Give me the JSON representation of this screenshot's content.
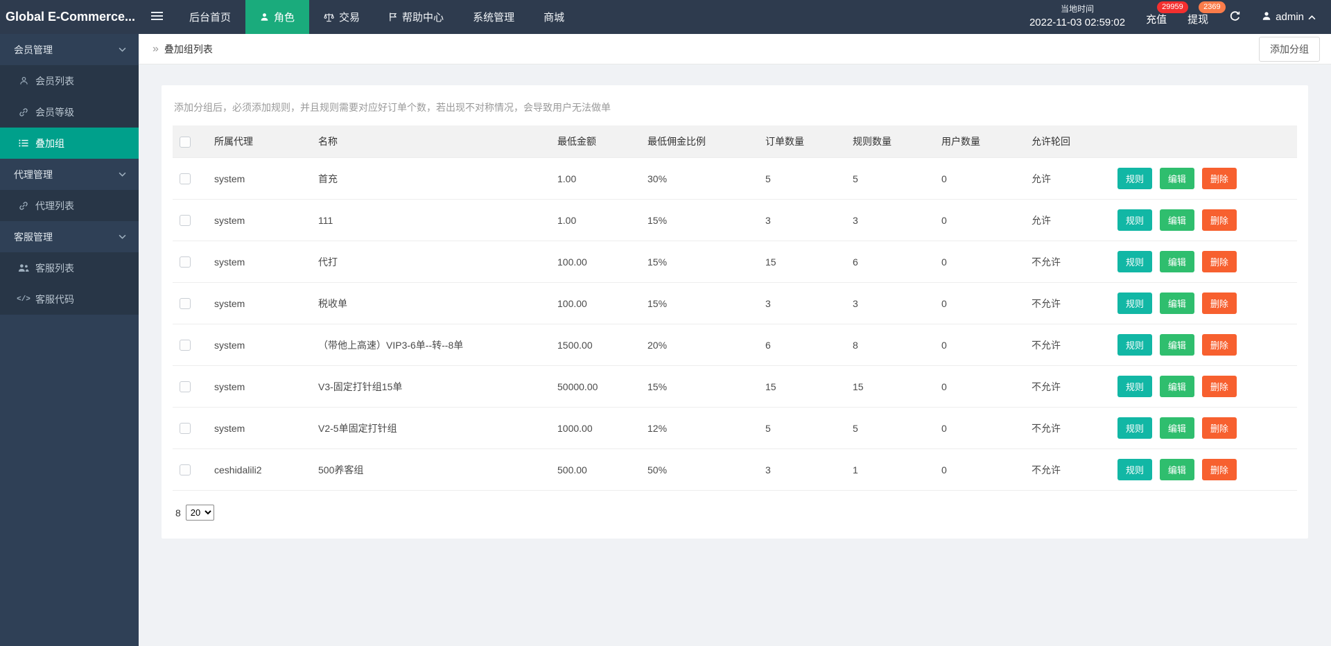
{
  "colors": {
    "header_bg": "#2e3b4e",
    "sidebar_bg": "#2f4056",
    "sidebar_child_bg": "#283647",
    "accent_green": "#00a08b",
    "nav_active_green": "#1aab7c",
    "btn_rule": "#12b7a5",
    "btn_edit": "#2fbe6e",
    "btn_delete": "#f7602f",
    "badge_red": "#f42f2f",
    "badge_orange": "#fb7c4a"
  },
  "header": {
    "logo": "Global E-Commerce...",
    "nav": [
      {
        "label": "后台首页"
      },
      {
        "label": "角色"
      },
      {
        "label": "交易"
      },
      {
        "label": "帮助中心"
      },
      {
        "label": "系统管理"
      },
      {
        "label": "商城"
      }
    ],
    "time_label": "当地时间",
    "time_value": "2022-11-03 02:59:02",
    "recharge_label": "充值",
    "recharge_badge": "29959",
    "withdraw_label": "提现",
    "withdraw_badge": "2369",
    "user": "admin"
  },
  "sidebar": {
    "groups": [
      {
        "label": "会员管理"
      },
      {
        "label": "代理管理"
      },
      {
        "label": "客服管理"
      }
    ],
    "items": {
      "member_list": "会员列表",
      "member_level": "会员等级",
      "overlay_group": "叠加组",
      "agent_list": "代理列表",
      "service_list": "客服列表",
      "service_code": "客服代码"
    },
    "code_icon_text": "</>"
  },
  "breadcrumb": {
    "title": "叠加组列表",
    "add_button": "添加分组"
  },
  "main": {
    "hint": "添加分组后，必须添加规则，并且规则需要对应好订单个数，若出现不对称情况，会导致用户无法做单",
    "table": {
      "columns": [
        "所属代理",
        "名称",
        "最低金额",
        "最低佣金比例",
        "订单数量",
        "规则数量",
        "用户数量",
        "允许轮回"
      ],
      "action_labels": {
        "rule": "规则",
        "edit": "编辑",
        "delete": "删除"
      },
      "rows": [
        {
          "agent": "system",
          "name": "首充",
          "min_amount": "1.00",
          "min_commission": "30%",
          "orders": "5",
          "rules": "5",
          "users": "0",
          "loop": "允许"
        },
        {
          "agent": "system",
          "name": "111",
          "min_amount": "1.00",
          "min_commission": "15%",
          "orders": "3",
          "rules": "3",
          "users": "0",
          "loop": "允许"
        },
        {
          "agent": "system",
          "name": "代打",
          "min_amount": "100.00",
          "min_commission": "15%",
          "orders": "15",
          "rules": "6",
          "users": "0",
          "loop": "不允许"
        },
        {
          "agent": "system",
          "name": "税收单",
          "min_amount": "100.00",
          "min_commission": "15%",
          "orders": "3",
          "rules": "3",
          "users": "0",
          "loop": "不允许"
        },
        {
          "agent": "system",
          "name": "（带他上高速）VIP3-6单--转--8单",
          "min_amount": "1500.00",
          "min_commission": "20%",
          "orders": "6",
          "rules": "8",
          "users": "0",
          "loop": "不允许"
        },
        {
          "agent": "system",
          "name": "V3-固定打针组15单",
          "min_amount": "50000.00",
          "min_commission": "15%",
          "orders": "15",
          "rules": "15",
          "users": "0",
          "loop": "不允许"
        },
        {
          "agent": "system",
          "name": "V2-5单固定打针组",
          "min_amount": "1000.00",
          "min_commission": "12%",
          "orders": "5",
          "rules": "5",
          "users": "0",
          "loop": "不允许"
        },
        {
          "agent": "ceshidalili2",
          "name": "500养客组",
          "min_amount": "500.00",
          "min_commission": "50%",
          "orders": "3",
          "rules": "1",
          "users": "0",
          "loop": "不允许"
        }
      ]
    },
    "pagination": {
      "total": "8",
      "page_size": "20"
    }
  }
}
